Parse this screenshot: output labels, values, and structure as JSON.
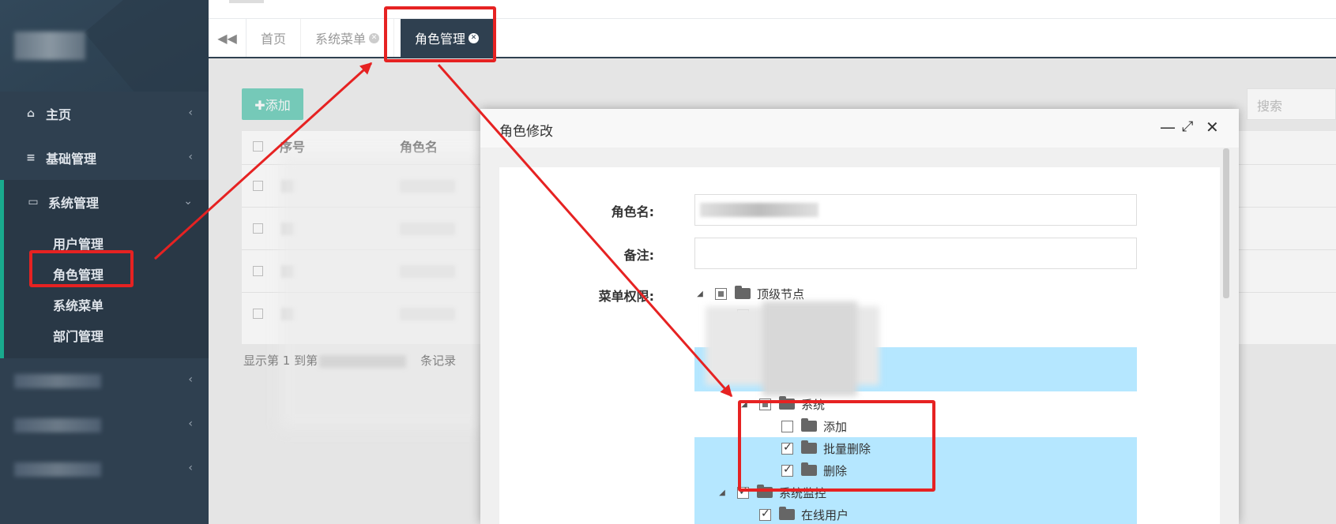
{
  "sidebar": {
    "items": [
      {
        "icon": "home-icon",
        "label": "主页"
      },
      {
        "icon": "list-icon",
        "label": "基础管理"
      },
      {
        "icon": "monitor-icon",
        "label": "系统管理"
      }
    ],
    "sub_items": [
      "用户管理",
      "角色管理",
      "系统菜单",
      "部门管理"
    ]
  },
  "tabs": {
    "items": [
      "首页",
      "系统菜单",
      "角色管理"
    ]
  },
  "content": {
    "add_label": "✚添加",
    "search_placeholder": "搜索",
    "table_headers": [
      "序号",
      "角色名"
    ],
    "pager_prefix": "显示第 1 到第",
    "pager_suffix": "条记录"
  },
  "modal": {
    "title": "角色修改",
    "labels": {
      "role_name": "角色名:",
      "remark": "备注:",
      "menu_perm": "菜单权限:"
    },
    "tree": {
      "root": "顶级节点",
      "group": "系统",
      "children": [
        "添加",
        "批量删除",
        "删除"
      ],
      "monitor": "系统监控",
      "online": "在线用户"
    }
  },
  "colors": {
    "sidebar_bg": "#2f4050",
    "accent_green": "#1ab394",
    "highlight_blue": "#b5e7ff",
    "annotation_red": "#e62222"
  }
}
